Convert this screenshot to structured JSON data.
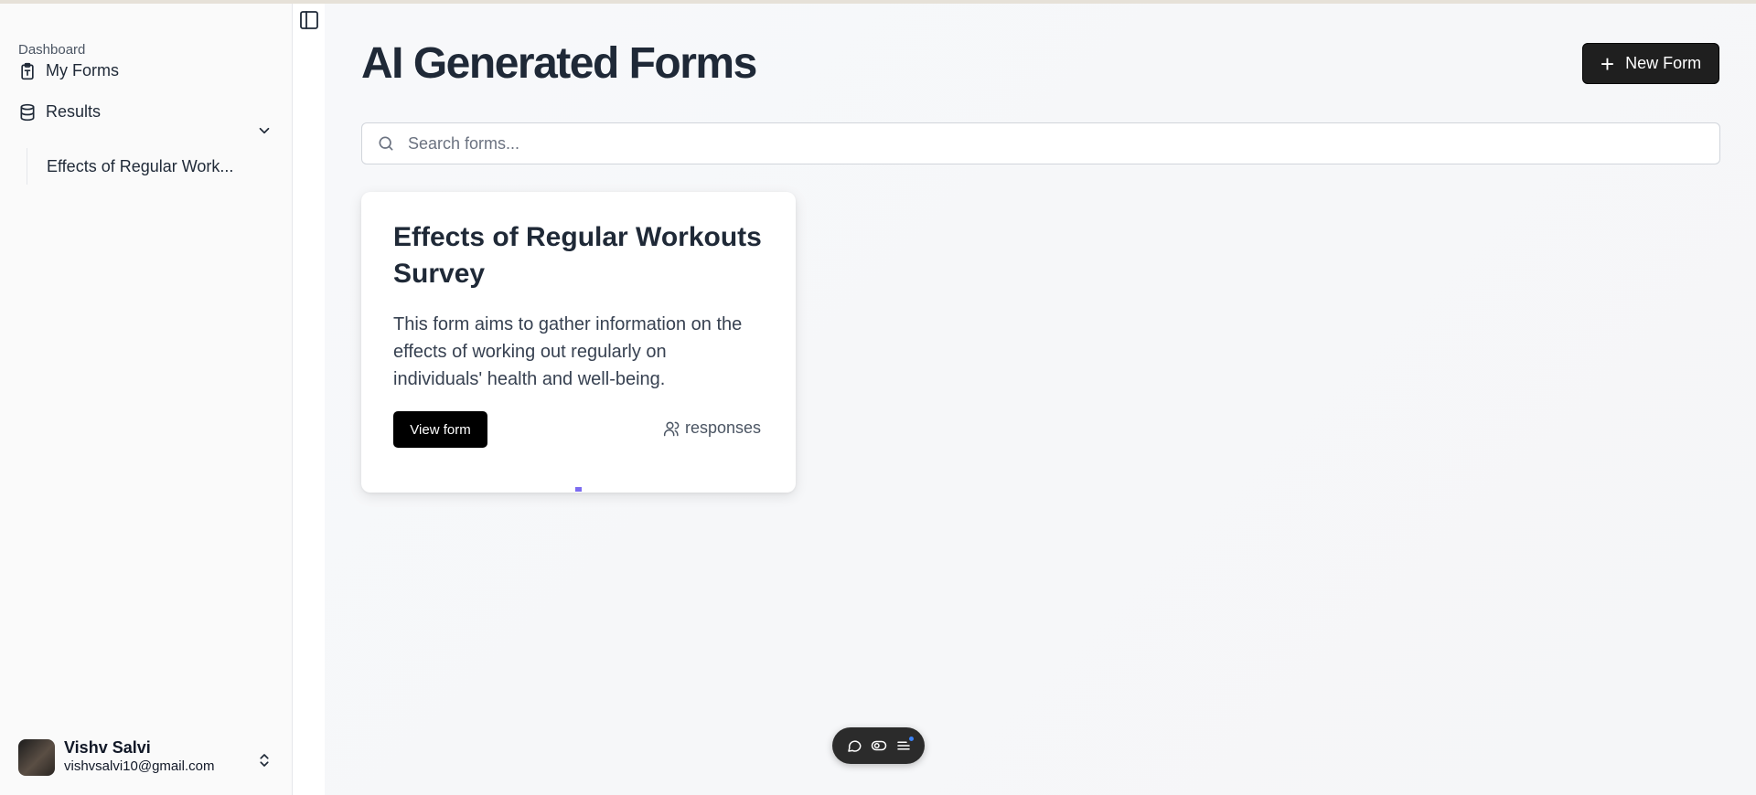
{
  "sidebar": {
    "section_label": "Dashboard",
    "items": [
      {
        "label": "My Forms",
        "icon": "clipboard-icon"
      },
      {
        "label": "Results",
        "icon": "database-icon"
      }
    ],
    "results_children": [
      {
        "label": "Effects of Regular Work..."
      }
    ]
  },
  "user": {
    "name": "Vishv Salvi",
    "email": "vishvsalvi10@gmail.com"
  },
  "main": {
    "title": "AI Generated Forms",
    "new_form_label": "New Form",
    "search": {
      "placeholder": "Search forms...",
      "value": ""
    },
    "forms": [
      {
        "title": "Effects of Regular Workouts Survey",
        "description": "This form aims to gather information on the effects of working out regularly on individuals' health and well-being.",
        "view_label": "View form",
        "responses_label": "responses"
      }
    ]
  },
  "colors": {
    "primary_button": "#1f1f1f",
    "view_button": "#000000",
    "accent_marker": "#7c6cf0",
    "floating_toolbar": "#2b2b2b"
  }
}
